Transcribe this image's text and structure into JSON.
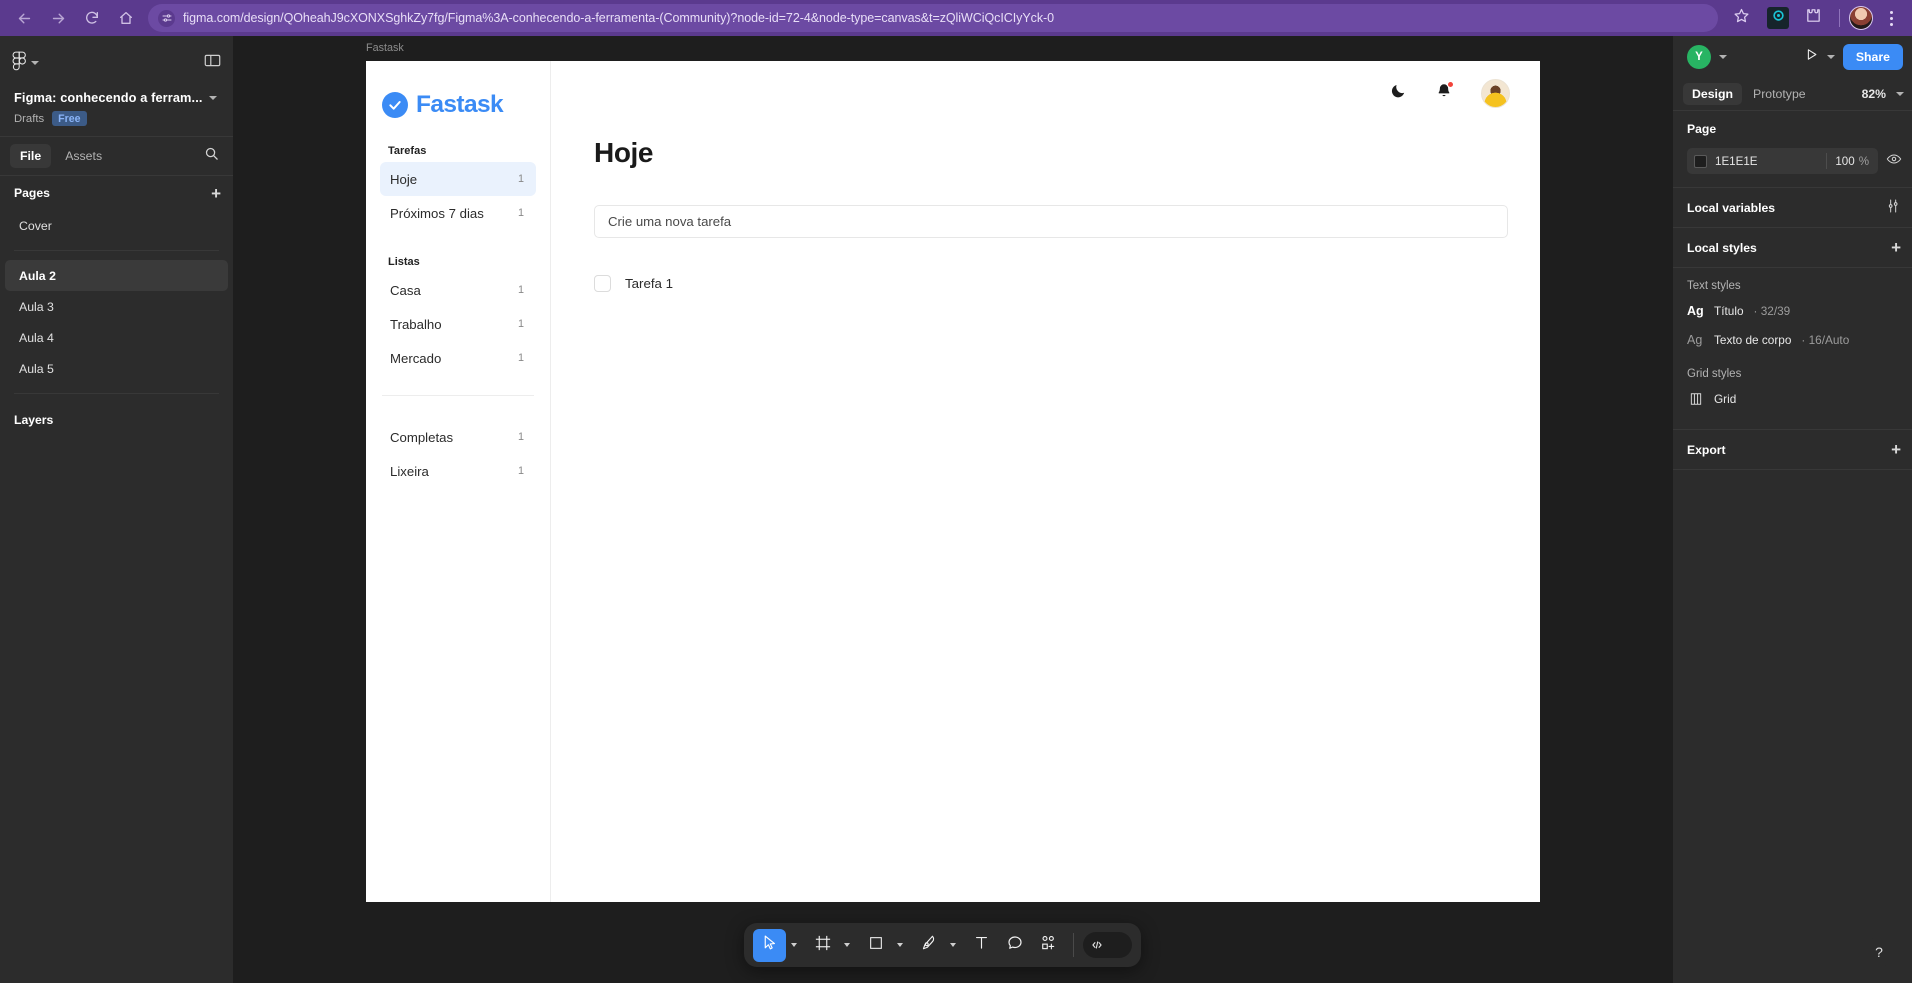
{
  "browser": {
    "url": "figma.com/design/QOheahJ9cXONXSghkZy7fg/Figma%3A-conhecendo-a-ferramenta-(Community)?node-id=72-4&node-type=canvas&t=zQliWCiQcICIyYck-0",
    "back_icon": "arrow-left-icon",
    "forward_icon": "arrow-right-icon",
    "reload_icon": "reload-icon",
    "home_icon": "home-icon",
    "site_settings_icon": "site-settings-icon",
    "bookmark_icon": "star-icon",
    "extension_icon": "extension-icon",
    "extensions_icon": "puzzle-piece-icon",
    "menu_icon": "kebab-menu-icon"
  },
  "figma": {
    "left_panel": {
      "menu_icon": "figma-logo-icon",
      "menu_chevron": "chevron-down-icon",
      "panel_toggle_icon": "panel-layout-icon",
      "file_title": "Figma: conhecendo a ferram...",
      "file_title_chevron": "chevron-down-icon",
      "project": "Drafts",
      "plan_badge": "Free",
      "tabs": [
        {
          "label": "File",
          "active": true
        },
        {
          "label": "Assets",
          "active": false
        }
      ],
      "search_icon": "search-icon",
      "pages_header": "Pages",
      "pages_add_icon": "plus-icon",
      "pages": [
        {
          "label": "Cover",
          "selected": false,
          "bold": false
        },
        {
          "label": "Aula 2",
          "selected": true,
          "bold": true
        },
        {
          "label": "Aula 3",
          "selected": false,
          "bold": false
        },
        {
          "label": "Aula 4",
          "selected": false,
          "bold": false
        },
        {
          "label": "Aula 5",
          "selected": false,
          "bold": false
        }
      ],
      "layers_header": "Layers"
    },
    "canvas": {
      "frame_label": "Fastask"
    },
    "right_panel": {
      "collaborator_initial": "Y",
      "collaborator_chevron": "chevron-down-icon",
      "present_icon": "play-icon",
      "present_chevron": "chevron-down-icon",
      "share_label": "Share",
      "tabs": [
        {
          "label": "Design",
          "active": true
        },
        {
          "label": "Prototype",
          "active": false
        }
      ],
      "zoom_level": "82%",
      "zoom_chevron": "chevron-down-icon",
      "page_section": {
        "title": "Page",
        "color_hex": "1E1E1E",
        "color_value": "#1E1E1E",
        "opacity": "100",
        "percent_symbol": "%",
        "visibility_icon": "eye-icon"
      },
      "local_variables": {
        "title": "Local variables",
        "icon": "variables-sliders-icon"
      },
      "local_styles": {
        "title": "Local styles",
        "add_icon": "plus-icon",
        "text_styles_label": "Text styles",
        "text_styles": [
          {
            "glyph": "Ag",
            "name": "Título",
            "meta": "· 32/39",
            "bold": true
          },
          {
            "glyph": "Ag",
            "name": "Texto de corpo",
            "meta": "· 16/Auto",
            "bold": false
          }
        ],
        "grid_styles_label": "Grid styles",
        "grid_styles": [
          {
            "icon": "grid-icon",
            "name": "Grid"
          }
        ]
      },
      "export": {
        "title": "Export",
        "add_icon": "plus-icon"
      }
    },
    "toolbar": {
      "tools": [
        {
          "name": "move-tool",
          "icon": "cursor-arrow-icon",
          "active": true,
          "chevron": true
        },
        {
          "name": "frame-tool",
          "icon": "frame-icon",
          "active": false,
          "chevron": true
        },
        {
          "name": "shape-tool",
          "icon": "square-icon",
          "active": false,
          "chevron": true
        },
        {
          "name": "pen-tool",
          "icon": "pen-icon",
          "active": false,
          "chevron": true
        },
        {
          "name": "text-tool",
          "icon": "text-t-icon",
          "active": false,
          "chevron": false
        },
        {
          "name": "comment-tool",
          "icon": "comment-bubble-icon",
          "active": false,
          "chevron": false
        },
        {
          "name": "actions-tool",
          "icon": "plugins-shapes-icon",
          "active": false,
          "chevron": false
        }
      ],
      "dev_mode_icon": "code-brackets-icon",
      "help_label": "?"
    }
  },
  "app": {
    "brand": {
      "name": "Fastask",
      "logo_icon": "check-circle-icon",
      "accent_color": "#3B8BF5"
    },
    "sidebar": {
      "groups": [
        {
          "label": "Tarefas",
          "items": [
            {
              "label": "Hoje",
              "count": "1",
              "active": true
            },
            {
              "label": "Próximos 7 dias",
              "count": "1",
              "active": false
            }
          ]
        },
        {
          "label": "Listas",
          "items": [
            {
              "label": "Casa",
              "count": "1",
              "active": false
            },
            {
              "label": "Trabalho",
              "count": "1",
              "active": false
            },
            {
              "label": "Mercado",
              "count": "1",
              "active": false
            }
          ]
        }
      ],
      "footer_items": [
        {
          "label": "Completas",
          "count": "1"
        },
        {
          "label": "Lixeira",
          "count": "1"
        }
      ]
    },
    "topbar": {
      "theme_icon": "moon-icon",
      "notifications_icon": "bell-icon",
      "avatar_icon": "user-avatar"
    },
    "main": {
      "title": "Hoje",
      "new_task_placeholder": "Crie uma nova tarefa",
      "tasks": [
        {
          "label": "Tarefa 1",
          "checked": false
        }
      ]
    }
  }
}
